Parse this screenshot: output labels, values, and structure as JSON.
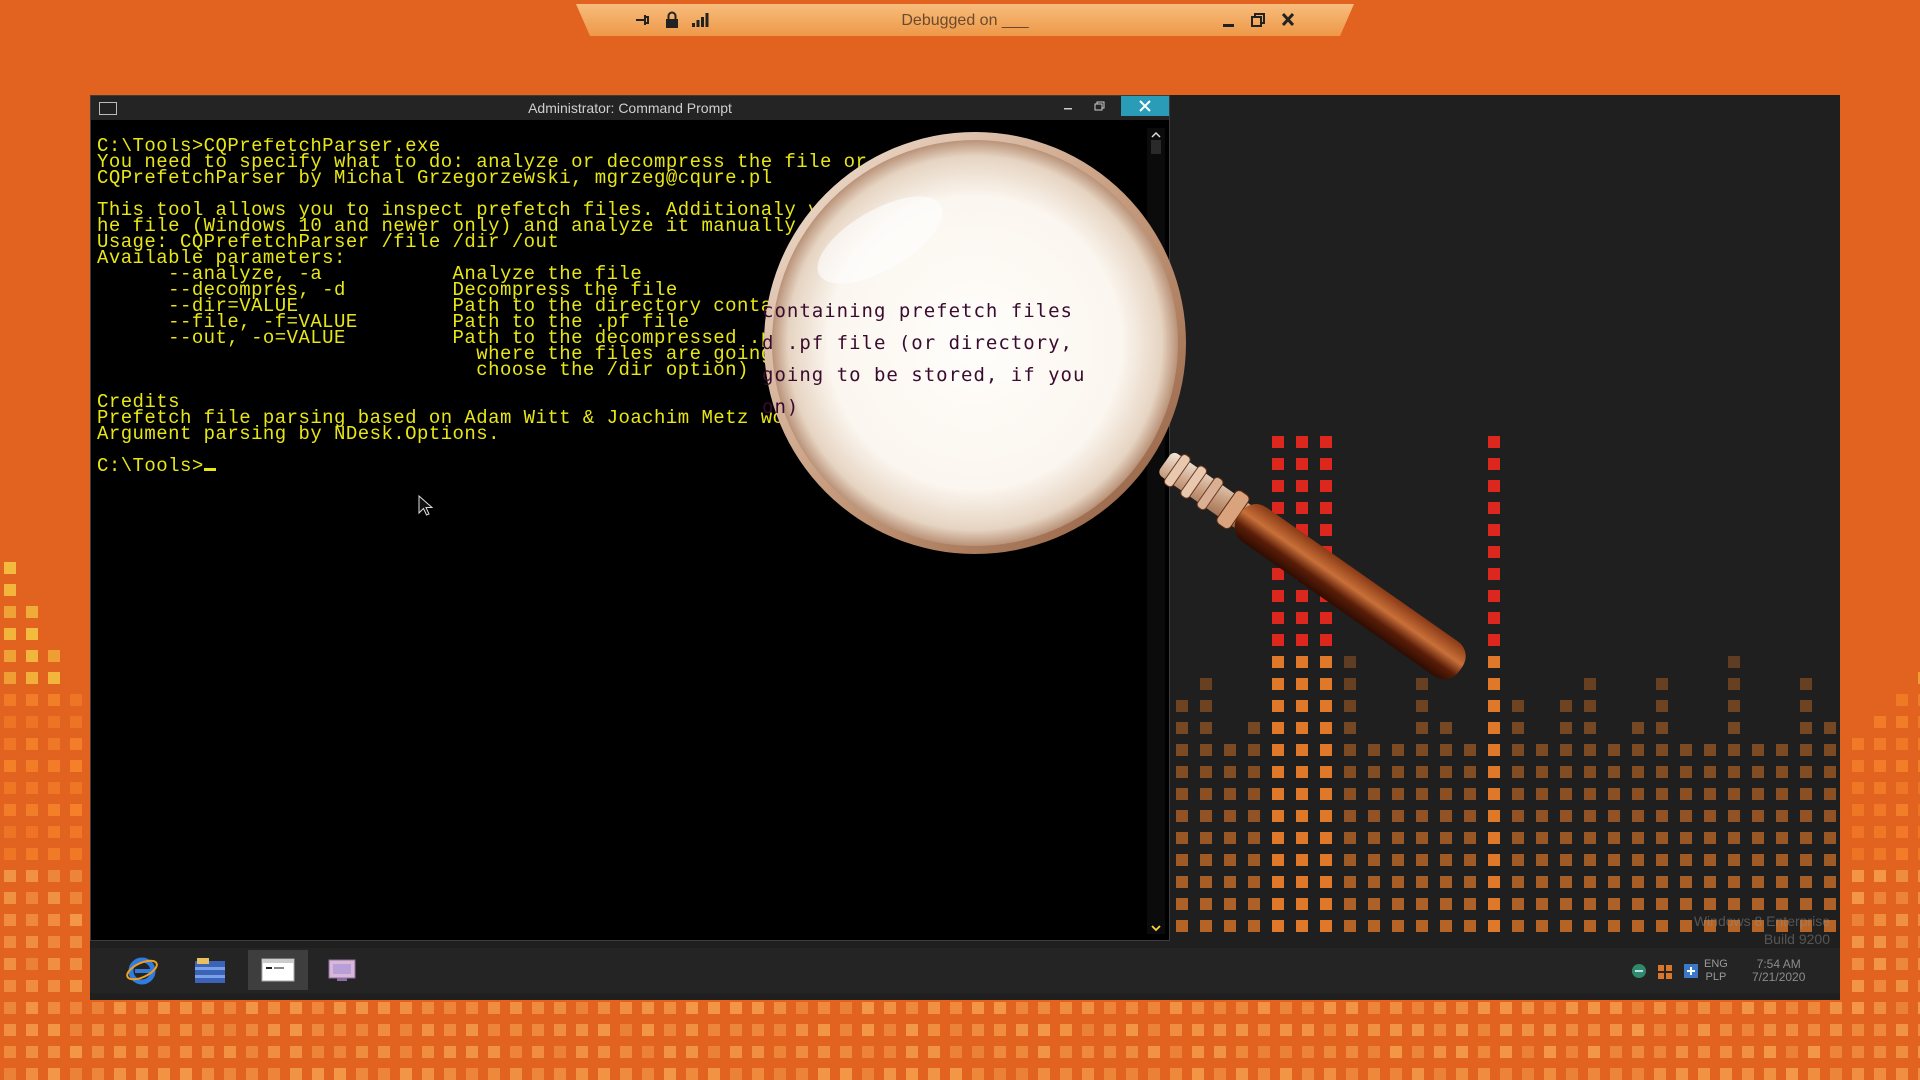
{
  "session_bar": {
    "title": "Debugged on ___",
    "icons": [
      "pin-icon",
      "lock-icon",
      "signal-bars-icon"
    ],
    "buttons": [
      "minimize-icon",
      "restore-icon",
      "close-icon"
    ]
  },
  "cmd": {
    "title": "Administrator: Command Prompt",
    "lines": [
      "C:\\Tools>CQPrefetchParser.exe",
      "You need to specify what to do: analyze or decompress the file or directory.",
      "CQPrefetchParser by Michal Grzegorzewski, mgrzeg@cqure.pl",
      "",
      "This tool allows you to inspect prefetch files. Additionaly you can decompress t",
      "he file (Windows 10 and newer only) and analyze it manually.",
      "Usage: CQPrefetchParser /file /dir /out",
      "Available parameters:",
      "      --analyze, -a           Analyze the file",
      "      --decompres, -d         Decompress the file",
      "      --dir=VALUE             Path to the directory containing prefetch files",
      "      --file, -f=VALUE        Path to the .pf file",
      "      --out, -o=VALUE         Path to the decompressed .pf file (or directory,",
      "                                where the files are going to be stored, if you",
      "                                choose the /dir option)",
      "",
      "Credits",
      "Prefetch file parsing based on Adam Witt & Joachim Metz works",
      "Argument parsing by NDesk.Options.",
      ""
    ],
    "prompt": "C:\\Tools>"
  },
  "magnifier": {
    "lines": [
      "containing prefetch files",
      "d .pf file (or directory,",
      "going to be stored, if you",
      "on)"
    ]
  },
  "taskbar": {
    "apps": [
      "internet-explorer-icon",
      "file-explorer-icon",
      "command-prompt-icon",
      "remote-desktop-icon"
    ],
    "tray_icons": [
      "network-icon",
      "security-icon",
      "update-icon"
    ],
    "lang_top": "ENG",
    "lang_bottom": "PLP",
    "time": "7:54 AM",
    "date": "7/21/2020"
  },
  "watermark": {
    "line1": "Windows 8 Enterprise",
    "line2": "Build 9200"
  },
  "colors": {
    "background": "#e2621f",
    "console_text": "#e7e718",
    "close_button": "#2b9cb8",
    "eq_red": "#f0281e",
    "eq_orange": "#f5822a",
    "eq_yellow": "#f5c542"
  }
}
